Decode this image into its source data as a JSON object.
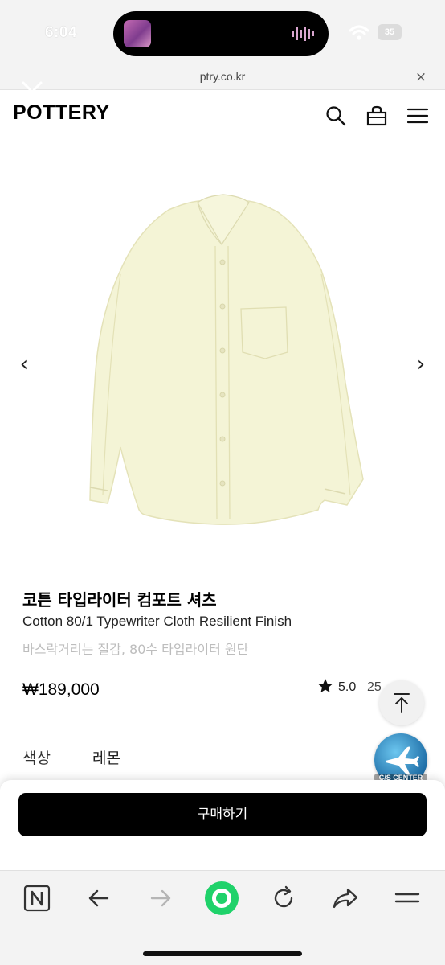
{
  "status_bar": {
    "time": "6:04",
    "battery": "35"
  },
  "browser": {
    "url": "ptry.co.kr",
    "close_label": "×"
  },
  "header": {
    "logo": "POTTERY"
  },
  "carousel": {
    "prev_label": "‹",
    "next_label": "›"
  },
  "product": {
    "title_ko": "코튼 타입라이터 컴포트 셔츠",
    "title_en": "Cotton 80/1 Typewriter Cloth Resilient Finish",
    "subtitle": "바스락거리는 질감, 80수 타입라이터 원단",
    "price": "₩189,000",
    "rating": "5.0",
    "review_count": "25",
    "shirt_color": "#f4f4d6"
  },
  "options": {
    "color_label": "색상",
    "color_value": "레몬"
  },
  "cs_center": {
    "label": "C/S CENTER"
  },
  "purchase": {
    "buy_label": "구매하기"
  },
  "toolbar": {
    "icons": [
      "naver-n-icon",
      "back-arrow-icon",
      "forward-arrow-icon",
      "green-home-icon",
      "reload-icon",
      "share-icon",
      "menu-icon"
    ]
  }
}
